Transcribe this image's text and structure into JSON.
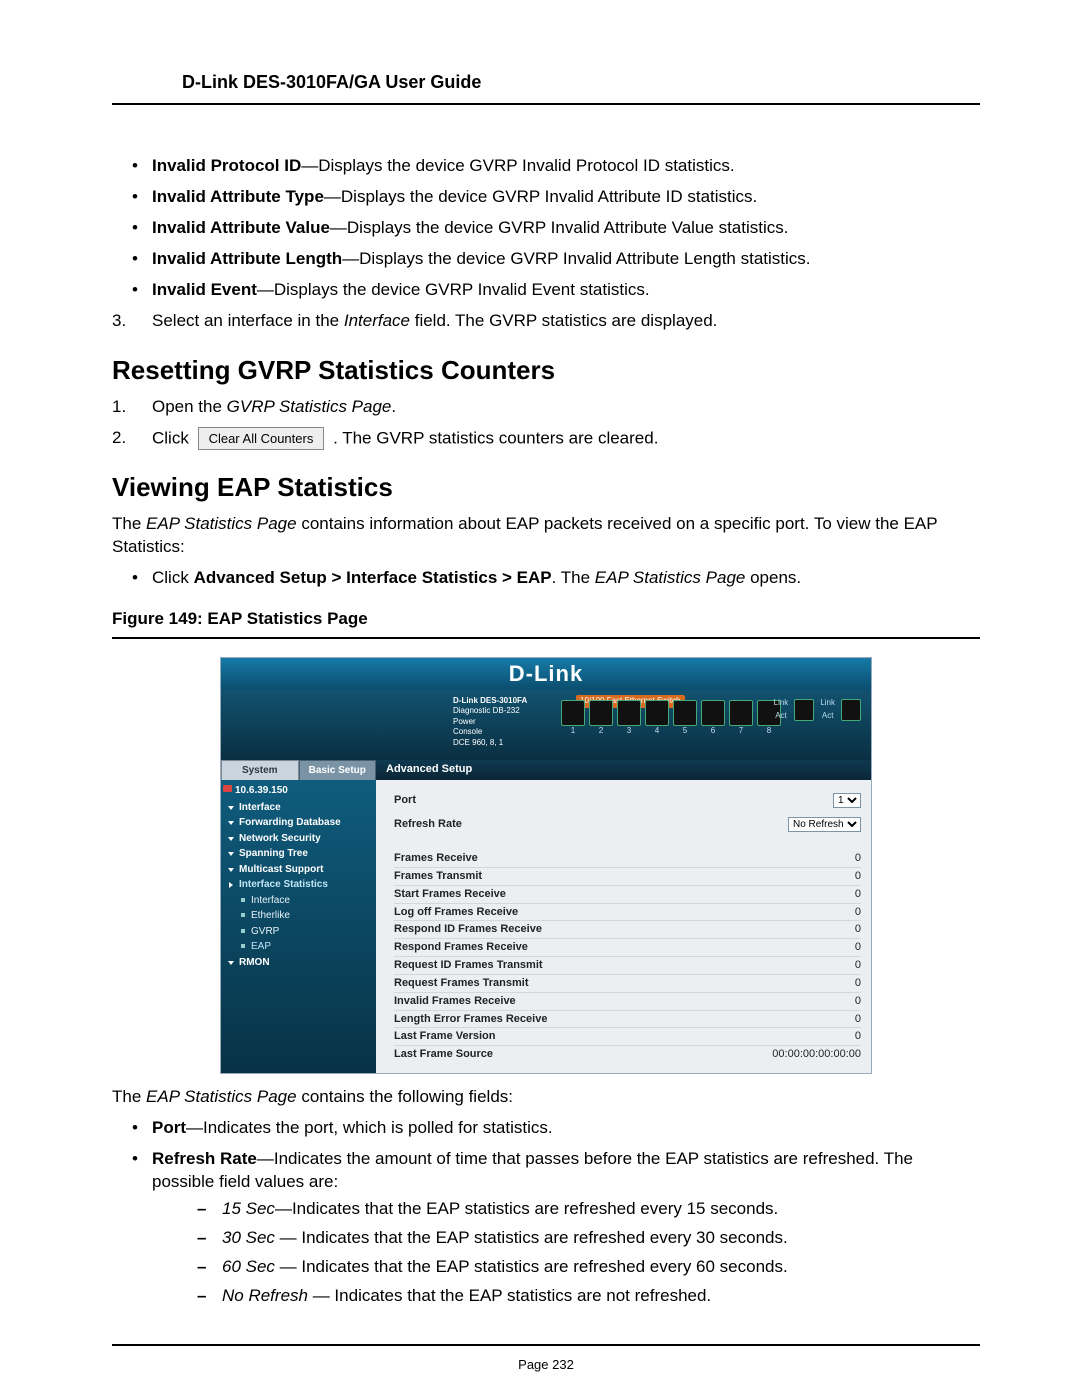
{
  "doc_title": "D-Link DES-3010FA/GA User Guide",
  "top_bullets": [
    {
      "term": "Invalid Protocol ID",
      "desc": "—Displays the device GVRP Invalid Protocol ID statistics."
    },
    {
      "term": "Invalid Attribute Type",
      "desc": "—Displays the device GVRP Invalid Attribute ID statistics."
    },
    {
      "term": "Invalid Attribute Value",
      "desc": "—Displays the device GVRP Invalid Attribute Value statistics."
    },
    {
      "term": "Invalid Attribute Length",
      "desc": "—Displays the device GVRP Invalid Attribute Length statistics."
    },
    {
      "term": "Invalid Event",
      "desc": "—Displays the device GVRP Invalid Event statistics."
    }
  ],
  "step3": {
    "num": "3.",
    "pre": "Select an interface in the ",
    "ital": "Interface",
    "post": " field. The GVRP statistics are displayed."
  },
  "section1_title": "Resetting GVRP Statistics Counters",
  "reset_steps": {
    "s1": {
      "num": "1.",
      "pre": "Open the ",
      "ital": "GVRP Statistics Page",
      "post": "."
    },
    "s2": {
      "num": "2.",
      "pre": "Click ",
      "btn": "Clear All Counters",
      "post": ". The GVRP statistics counters are cleared."
    }
  },
  "section2_title": "Viewing EAP Statistics",
  "eap_intro": {
    "pre": "The ",
    "ital": "EAP Statistics Page",
    "post": " contains information about EAP packets received on a specific port. To view the EAP Statistics:"
  },
  "eap_bullet": {
    "pre": "Click ",
    "bold": "Advanced Setup > Interface Statistics > EAP",
    "mid": ". The ",
    "ital": "EAP Statistics Page",
    "post": " opens."
  },
  "figure_caption": "Figure 149: EAP Statistics Page",
  "app": {
    "brand": "D-Link",
    "device_row": {
      "model": "D-Link DES-3010FA",
      "sub": "Diagnostic DB-232",
      "labels": {
        "power": "Power",
        "console": "Console",
        "dce": "DCE 960, 8, 1"
      },
      "badge": "10/100 Fast Ethernet Switch",
      "right": {
        "link": "Link",
        "act": "Act"
      }
    },
    "tabs": {
      "system": "System",
      "basic": "Basic Setup",
      "advanced": "Advanced Setup"
    },
    "sidebar": {
      "ip": "10.6.39.150",
      "items": [
        {
          "label": "Interface",
          "type": "expand"
        },
        {
          "label": "Forwarding Database",
          "type": "expand"
        },
        {
          "label": "Network Security",
          "type": "expand"
        },
        {
          "label": "Spanning Tree",
          "type": "expand"
        },
        {
          "label": "Multicast Support",
          "type": "expand"
        },
        {
          "label": "Interface Statistics",
          "type": "collapsed",
          "active": true
        },
        {
          "label": "Interface",
          "type": "sub"
        },
        {
          "label": "Etherlike",
          "type": "sub"
        },
        {
          "label": "GVRP",
          "type": "sub"
        },
        {
          "label": "EAP",
          "type": "sub",
          "active": true
        },
        {
          "label": "RMON",
          "type": "expand"
        }
      ]
    },
    "panel": {
      "port_label": "Port",
      "port_value": "1",
      "refresh_label": "Refresh Rate",
      "refresh_value": "No Refresh",
      "rows": [
        {
          "label": "Frames Receive",
          "value": "0"
        },
        {
          "label": "Frames Transmit",
          "value": "0"
        },
        {
          "label": "Start Frames Receive",
          "value": "0"
        },
        {
          "label": "Log off Frames Receive",
          "value": "0"
        },
        {
          "label": "Respond ID Frames Receive",
          "value": "0"
        },
        {
          "label": "Respond Frames Receive",
          "value": "0"
        },
        {
          "label": "Request ID Frames Transmit",
          "value": "0"
        },
        {
          "label": "Request Frames Transmit",
          "value": "0"
        },
        {
          "label": "Invalid Frames Receive",
          "value": "0"
        },
        {
          "label": "Length Error Frames Receive",
          "value": "0"
        },
        {
          "label": "Last Frame Version",
          "value": "0"
        },
        {
          "label": "Last Frame Source",
          "value": "00:00:00:00:00:00"
        }
      ]
    }
  },
  "app_following": {
    "pre": "The ",
    "ital": "EAP Statistics Page",
    "post": " contains the following fields:"
  },
  "field_bullets": {
    "port": {
      "term": "Port",
      "desc": "—Indicates the port, which is polled for statistics."
    },
    "refresh": {
      "term": "Refresh Rate",
      "desc": "—Indicates the amount of time that passes before the EAP statistics are refreshed. The possible field values are:"
    },
    "subs": [
      {
        "ital": "15 Sec",
        "desc": "—Indicates that the EAP statistics are refreshed every 15 seconds."
      },
      {
        "ital": "30 Sec",
        "desc": " — Indicates that the EAP statistics are refreshed every 30 seconds."
      },
      {
        "ital": "60 Sec",
        "desc": " — Indicates that the EAP statistics are refreshed every 60 seconds."
      },
      {
        "ital": "No Refresh",
        "desc": " — Indicates that the EAP statistics are not refreshed."
      }
    ]
  },
  "page_number": "Page 232"
}
